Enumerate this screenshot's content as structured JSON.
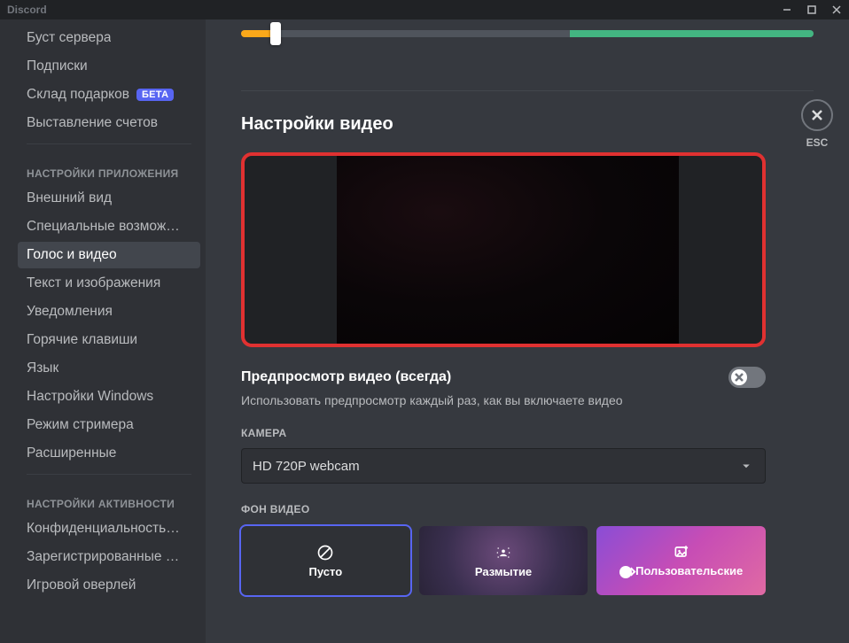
{
  "window": {
    "title": "Discord",
    "esc_label": "ESC"
  },
  "sidebar": {
    "billing_items": [
      {
        "label": "Буст сервера"
      },
      {
        "label": "Подписки"
      },
      {
        "label": "Склад подарков",
        "badge": "БЕТА"
      },
      {
        "label": "Выставление счетов"
      }
    ],
    "app_header": "НАСТРОЙКИ ПРИЛОЖЕНИЯ",
    "app_items": [
      {
        "label": "Внешний вид"
      },
      {
        "label": "Специальные возмож…"
      },
      {
        "label": "Голос и видео",
        "active": true
      },
      {
        "label": "Текст и изображения"
      },
      {
        "label": "Уведомления"
      },
      {
        "label": "Горячие клавиши"
      },
      {
        "label": "Язык"
      },
      {
        "label": "Настройки Windows"
      },
      {
        "label": "Режим стримера"
      },
      {
        "label": "Расширенные"
      }
    ],
    "activity_header": "НАСТРОЙКИ АКТИВНОСТИ",
    "activity_items": [
      {
        "label": "Конфиденциальность…"
      },
      {
        "label": "Зарегистрированные …"
      },
      {
        "label": "Игровой оверлей"
      }
    ]
  },
  "content": {
    "section_title": "Настройки видео",
    "preview_toggle": {
      "title": "Предпросмотр видео (всегда)",
      "desc": "Использовать предпросмотр каждый раз, как вы включаете видео",
      "on": false
    },
    "camera": {
      "label": "КАМЕРА",
      "value": "HD 720P webcam"
    },
    "background": {
      "label": "ФОН ВИДЕО",
      "options": {
        "none": "Пусто",
        "blur": "Размытие",
        "custom": "Пользовательские"
      },
      "selected": "none"
    }
  }
}
